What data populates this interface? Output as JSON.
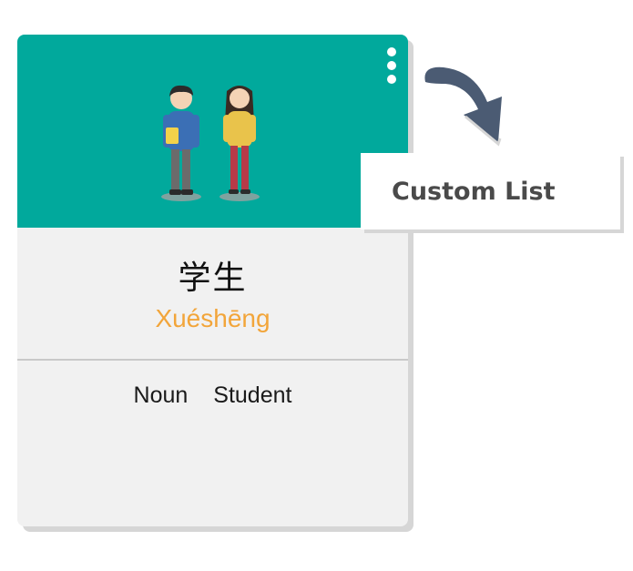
{
  "card": {
    "header_color": "#01a99c",
    "menu_icon": "more-vertical-icon",
    "illustration": "students-illustration",
    "word": {
      "hanzi": "学生",
      "pinyin": "Xuéshēng"
    },
    "definition": {
      "part_of_speech": "Noun",
      "meaning": "Student"
    }
  },
  "popup": {
    "label": "Custom List",
    "arrow_icon": "curved-arrow-icon"
  },
  "colors": {
    "accent": "#01a99c",
    "pinyin": "#f2a53a",
    "arrow": "#4b5b73"
  }
}
